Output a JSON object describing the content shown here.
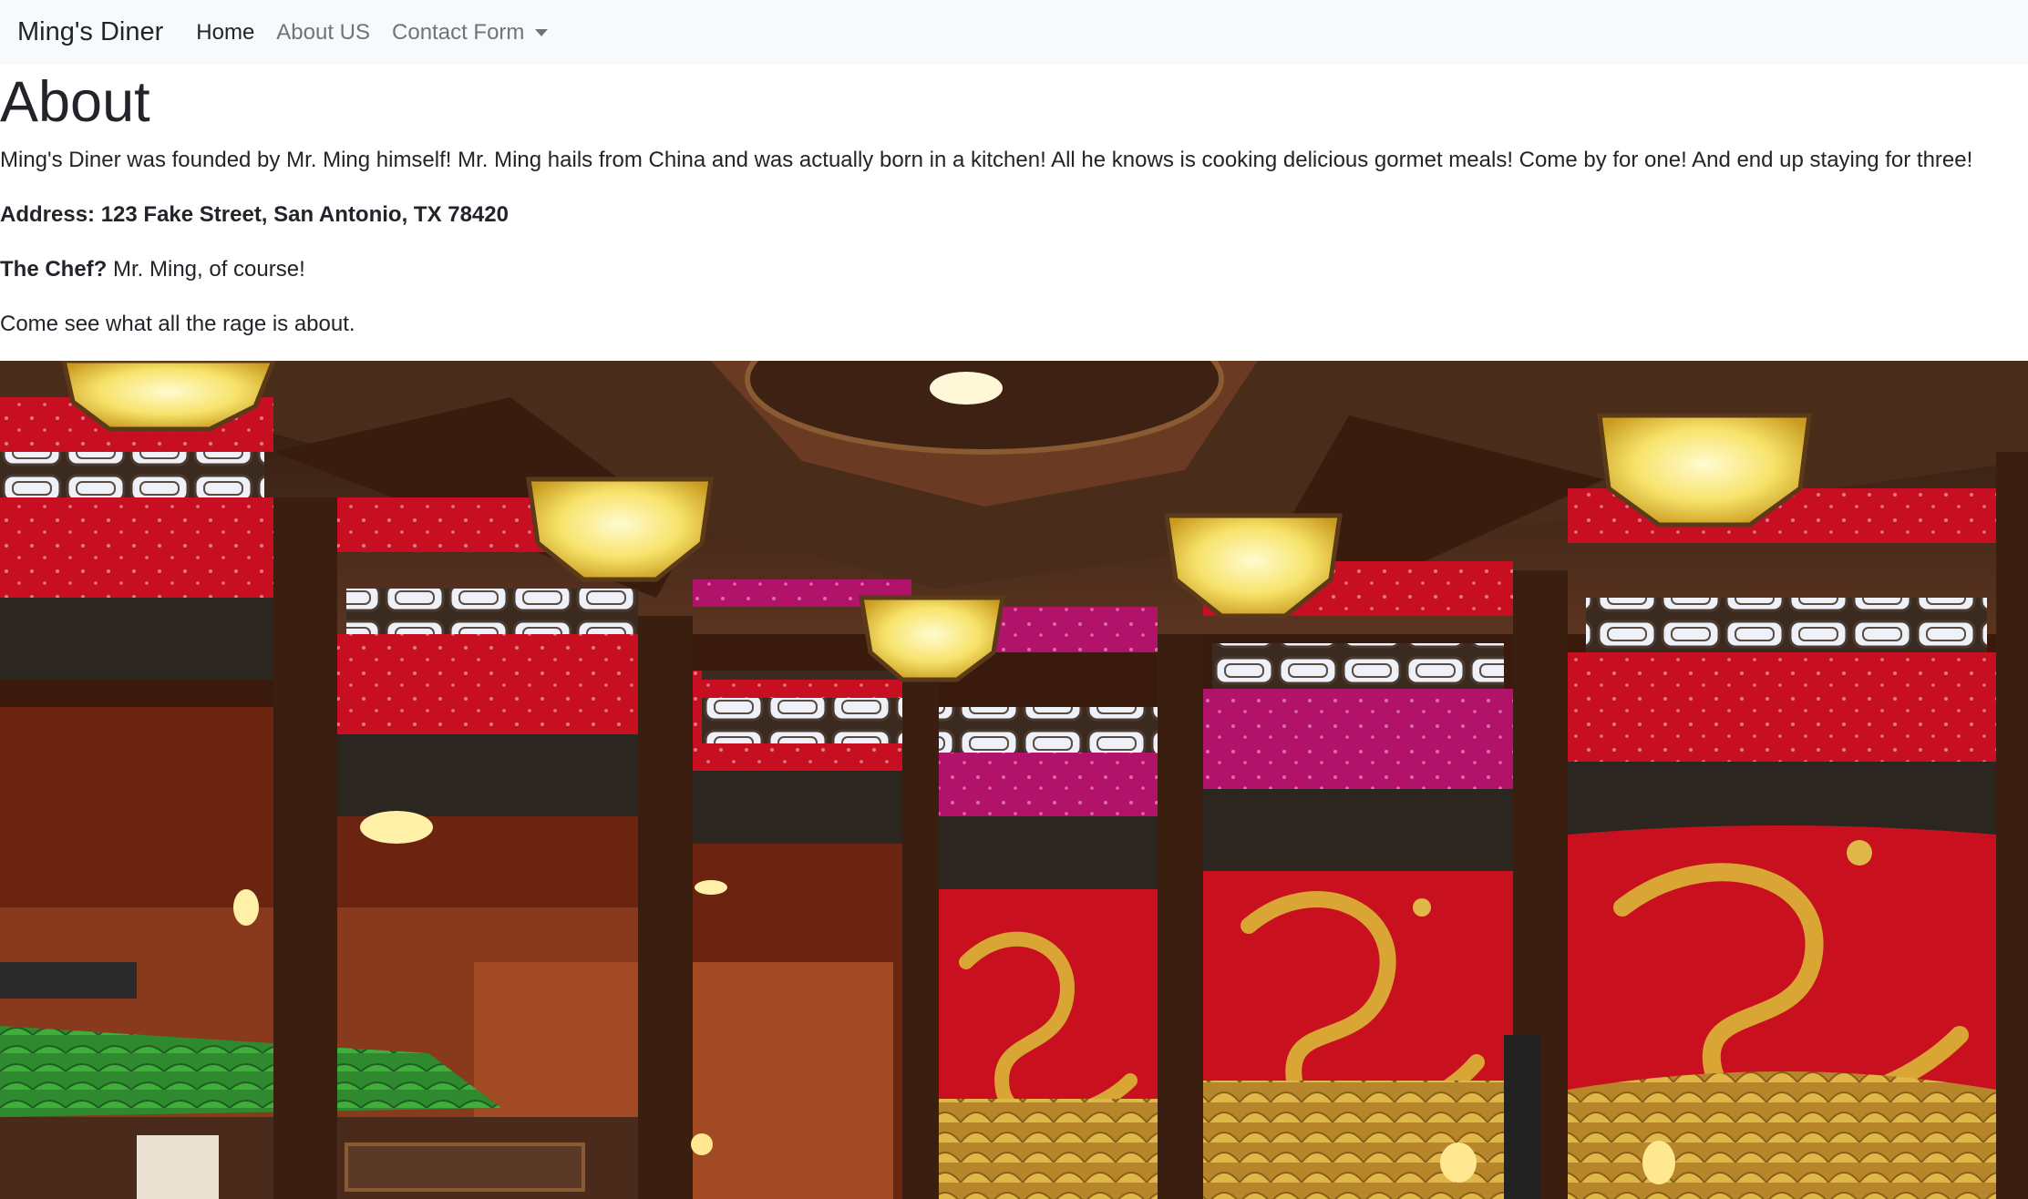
{
  "navbar": {
    "brand": "Ming's Diner",
    "links": [
      {
        "label": "Home",
        "active": true
      },
      {
        "label": "About US",
        "active": false
      },
      {
        "label": "Contact Form",
        "active": false,
        "dropdown": true
      }
    ]
  },
  "main": {
    "heading": "About",
    "intro": "Ming's Diner was founded by Mr. Ming himself! Mr. Ming hails from China and was actually born in a kitchen! All he knows is cooking delicious gormet meals! Come by for one! And end up staying for three!",
    "address": "Address: 123 Fake Street, San Antonio, TX 78420",
    "chef_label": "The Chef?",
    "chef_value": " Mr. Ming, of course!",
    "closing": "Come see what all the rage is about."
  },
  "colors": {
    "navbar_bg": "#f8f9fa",
    "text": "#212529",
    "muted_link": "#6c757d",
    "wall_red": "#c0101e",
    "dragon_gold": "#d4a32c"
  }
}
